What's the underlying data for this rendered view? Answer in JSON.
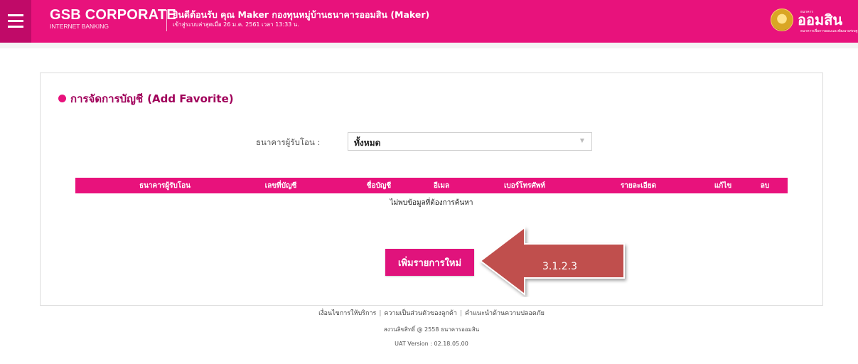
{
  "header": {
    "brand_name": "GSB CORPORATE",
    "brand_sub": "INTERNET BANKING",
    "welcome_line": "ยินดีต้อนรับ คุณ Maker กองทุนหมู่บ้านธนาคารออมสิน (Maker)",
    "last_login": "เข้าสู่ระบบล่าสุดเมื่อ 26 ม.ค. 2561 เวลา 13:33 น.",
    "logo_text": "ออมสิน",
    "logo_tiny": "ธนาคาร",
    "logo_tagline": "ธนาคารเพื่อการออมและพัฒนาเศรษฐกิจฐานราก",
    "accent_color": "#e8127c"
  },
  "page": {
    "title_th": "การจัดการบัญชี",
    "title_en": "(Add Favorite)"
  },
  "filter": {
    "label": "ธนาคารผู้รับโอน :",
    "selected": "ทั้งหมด"
  },
  "table": {
    "columns": [
      "ธนาคารผู้รับโอน",
      "เลขที่บัญชี",
      "ชื่อบัญชี",
      "อีเมล",
      "เบอร์โทรศัพท์",
      "รายละเอียด",
      "แก้ไข",
      "ลบ"
    ],
    "empty_message": "ไม่พบข้อมูลที่ต้องการค้นหา"
  },
  "actions": {
    "add_label": "เพิ่มรายการใหม่"
  },
  "annotation": {
    "label": "3.1.2.3"
  },
  "footer": {
    "link_terms": "เงื่อนไขการให้บริการ",
    "link_privacy": "ความเป็นส่วนตัวของลูกค้า",
    "link_security": "คำแนะนำด้านความปลอดภัย",
    "separator": "|",
    "copyright": "สงวนลิขสิทธิ์ @ 2558 ธนาคารออมสิน",
    "version": "UAT Version : 02.18.05.00"
  }
}
